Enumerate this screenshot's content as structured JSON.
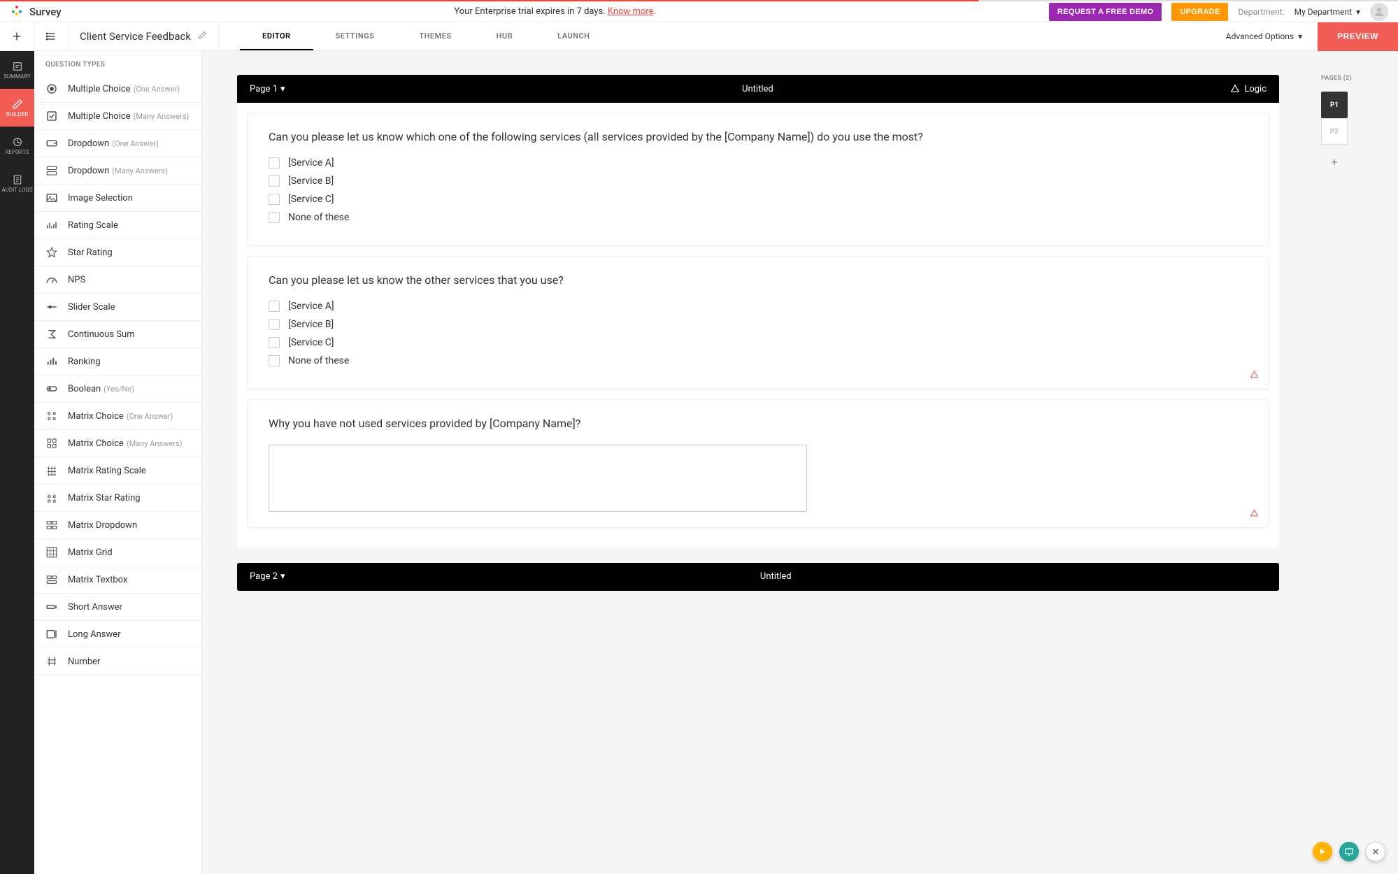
{
  "header": {
    "brand": "Survey",
    "trial_msg": "Your Enterprise trial expires in 7 days. ",
    "trial_link": "Know more",
    "trial_suffix": ".",
    "demo_btn": "REQUEST A FREE DEMO",
    "upgrade_btn": "UPGRADE",
    "dept_label": "Department:",
    "dept_value": "My Department"
  },
  "secnav": {
    "survey_title": "Client Service Feedback",
    "tabs": [
      "EDITOR",
      "SETTINGS",
      "THEMES",
      "HUB",
      "LAUNCH"
    ],
    "adv_opts": "Advanced Options",
    "preview": "PREVIEW"
  },
  "rail": {
    "items": [
      {
        "label": "SUMMARY"
      },
      {
        "label": "BUILDER"
      },
      {
        "label": "REPORTS"
      },
      {
        "label": "AUDIT LOGS"
      }
    ]
  },
  "qtypes": {
    "header": "QUESTION TYPES",
    "items": [
      {
        "label": "Multiple Choice",
        "hint": "(One Answer)",
        "icon": "radio"
      },
      {
        "label": "Multiple Choice",
        "hint": "(Many Answers)",
        "icon": "check"
      },
      {
        "label": "Dropdown",
        "hint": "(One Answer)",
        "icon": "dropdown"
      },
      {
        "label": "Dropdown",
        "hint": "(Many Answers)",
        "icon": "dropdown-multi"
      },
      {
        "label": "Image Selection",
        "hint": "",
        "icon": "image"
      },
      {
        "label": "Rating Scale",
        "hint": "",
        "icon": "rating"
      },
      {
        "label": "Star Rating",
        "hint": "",
        "icon": "star"
      },
      {
        "label": "NPS",
        "hint": "",
        "icon": "nps"
      },
      {
        "label": "Slider Scale",
        "hint": "",
        "icon": "slider"
      },
      {
        "label": "Continuous Sum",
        "hint": "",
        "icon": "sum"
      },
      {
        "label": "Ranking",
        "hint": "",
        "icon": "ranking"
      },
      {
        "label": "Boolean",
        "hint": "(Yes/No)",
        "icon": "boolean"
      },
      {
        "label": "Matrix Choice",
        "hint": "(One Answer)",
        "icon": "matrix-radio"
      },
      {
        "label": "Matrix Choice",
        "hint": "(Many Answers)",
        "icon": "matrix-check"
      },
      {
        "label": "Matrix Rating Scale",
        "hint": "",
        "icon": "matrix-rating"
      },
      {
        "label": "Matrix Star Rating",
        "hint": "",
        "icon": "matrix-star"
      },
      {
        "label": "Matrix Dropdown",
        "hint": "",
        "icon": "matrix-dd"
      },
      {
        "label": "Matrix Grid",
        "hint": "",
        "icon": "grid"
      },
      {
        "label": "Matrix Textbox",
        "hint": "",
        "icon": "matrix-tb"
      },
      {
        "label": "Short Answer",
        "hint": "",
        "icon": "short"
      },
      {
        "label": "Long Answer",
        "hint": "",
        "icon": "long"
      },
      {
        "label": "Number",
        "hint": "",
        "icon": "number"
      }
    ]
  },
  "canvas": {
    "page1_label": "Page 1",
    "page1_title": "Untitled",
    "logic_label": "Logic",
    "questions": [
      {
        "text": "Can you please let us know which one of the following services (all services provided by the [Company Name]) do you use the most?",
        "options": [
          "[Service A]",
          "[Service B]",
          "[Service C]",
          "None of these"
        ],
        "has_logic": false
      },
      {
        "text": "Can you please let us know the other services that you use?",
        "options": [
          "[Service A]",
          "[Service B]",
          "[Service C]",
          "None of these"
        ],
        "has_logic": true
      },
      {
        "text": "Why you have not used services provided by [Company Name]?",
        "type": "textarea",
        "has_logic": true
      }
    ],
    "page2_label": "Page 2",
    "page2_title": "Untitled"
  },
  "pages": {
    "header": "PAGES (2)",
    "items": [
      {
        "label": "P1",
        "active": true
      },
      {
        "label": "P2",
        "active": false
      }
    ]
  },
  "colors": {
    "accent_red": "#f25c54",
    "purple": "#9c27b0",
    "orange": "#ff9800"
  }
}
